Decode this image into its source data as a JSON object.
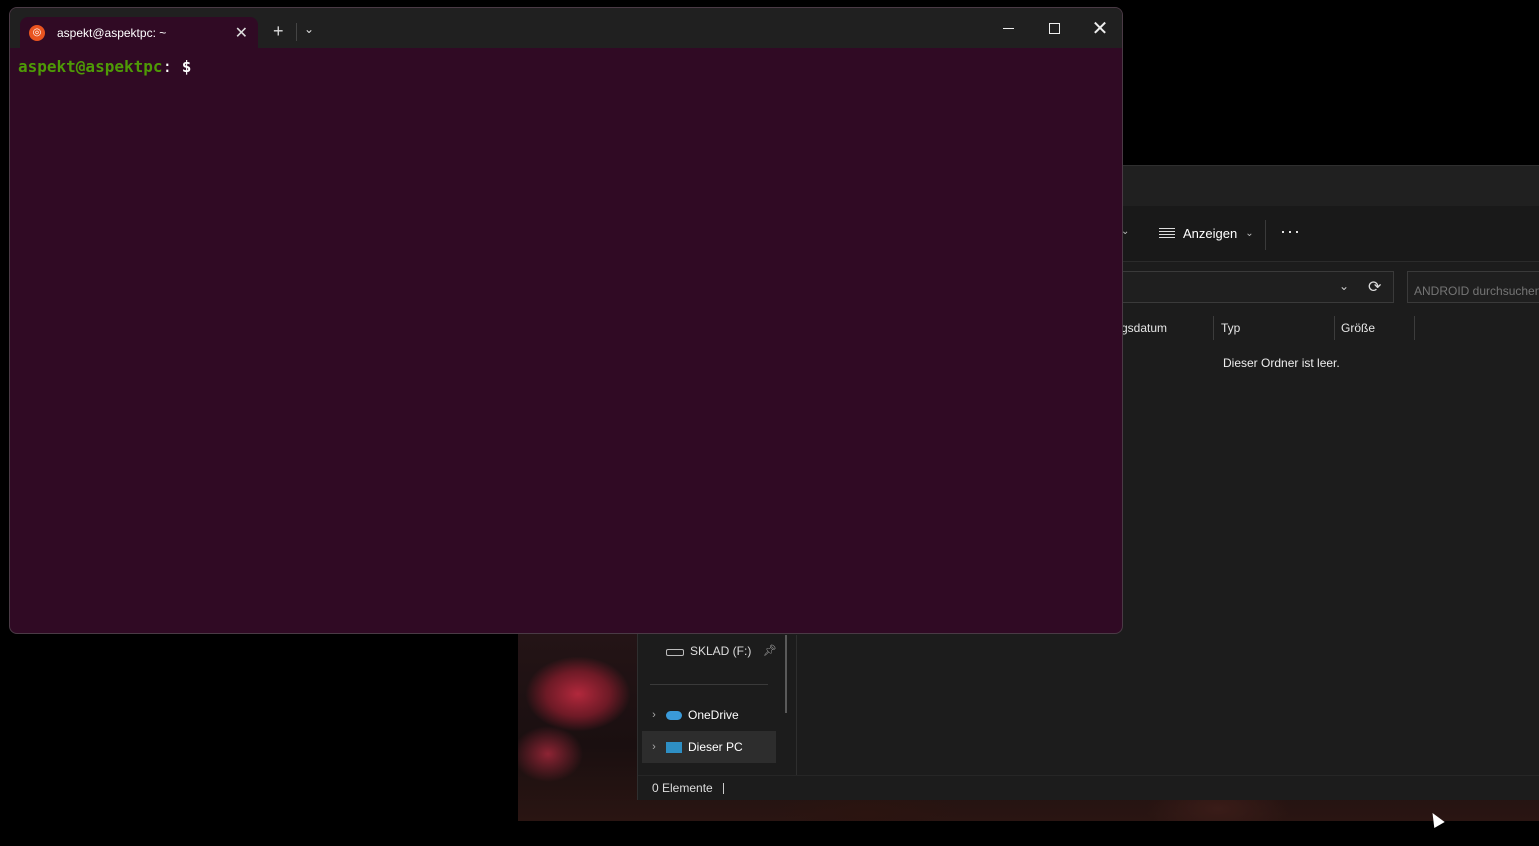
{
  "terminal": {
    "tab_title": "aspekt@aspektpc: ~",
    "prompt_user": "aspekt@aspektpc",
    "prompt_sep": ":",
    "prompt_path": "",
    "prompt_dollar": " $",
    "new_tab_icon": "+",
    "dropdown_icon": "⌄",
    "close_tab_icon": "✕",
    "close_window_icon": "✕",
    "background_color": "#300a24"
  },
  "explorer": {
    "toolbar": {
      "view_label": "Anzeigen",
      "view_chevron": "⌄",
      "more_label": "···"
    },
    "search_placeholder": "ANDROID durchsuchen",
    "columns": [
      {
        "label": "gsdatum"
      },
      {
        "label": "Typ"
      },
      {
        "label": "Größe"
      }
    ],
    "empty_message": "Dieser Ordner ist leer.",
    "nav": {
      "drive_label": "SKLAD (F:)",
      "onedrive_label": "OneDrive",
      "thispc_label": "Dieser PC"
    },
    "status": {
      "count_label": "0 Elemente"
    }
  }
}
